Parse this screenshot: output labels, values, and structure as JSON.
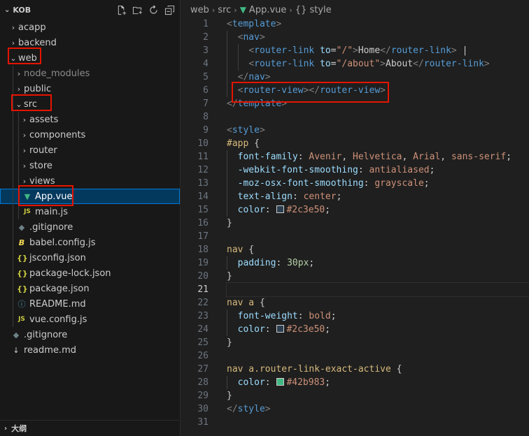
{
  "explorer": {
    "root": "KOB",
    "actions": [
      "new-file-icon",
      "new-folder-icon",
      "refresh-icon",
      "collapse-all-icon"
    ],
    "tree": [
      {
        "label": "acapp",
        "kind": "folder",
        "depth": 1,
        "expanded": false
      },
      {
        "label": "backend",
        "kind": "folder",
        "depth": 1,
        "expanded": false
      },
      {
        "label": "web",
        "kind": "folder",
        "depth": 1,
        "expanded": true
      },
      {
        "label": "node_modules",
        "kind": "folder",
        "depth": 2,
        "expanded": false,
        "dim": true
      },
      {
        "label": "public",
        "kind": "folder",
        "depth": 2,
        "expanded": false
      },
      {
        "label": "src",
        "kind": "folder",
        "depth": 2,
        "expanded": true
      },
      {
        "label": "assets",
        "kind": "folder",
        "depth": 3,
        "expanded": false
      },
      {
        "label": "components",
        "kind": "folder",
        "depth": 3,
        "expanded": false
      },
      {
        "label": "router",
        "kind": "folder",
        "depth": 3,
        "expanded": false
      },
      {
        "label": "store",
        "kind": "folder",
        "depth": 3,
        "expanded": false
      },
      {
        "label": "views",
        "kind": "folder",
        "depth": 3,
        "expanded": false
      },
      {
        "label": "App.vue",
        "kind": "vue",
        "depth": 3,
        "selected": true
      },
      {
        "label": "main.js",
        "kind": "js",
        "depth": 3
      },
      {
        "label": ".gitignore",
        "kind": "git",
        "depth": 2
      },
      {
        "label": "babel.config.js",
        "kind": "babel",
        "depth": 2
      },
      {
        "label": "jsconfig.json",
        "kind": "json",
        "depth": 2
      },
      {
        "label": "package-lock.json",
        "kind": "json",
        "depth": 2
      },
      {
        "label": "package.json",
        "kind": "json",
        "depth": 2
      },
      {
        "label": "README.md",
        "kind": "info",
        "depth": 2
      },
      {
        "label": "vue.config.js",
        "kind": "js",
        "depth": 2
      },
      {
        "label": ".gitignore",
        "kind": "git",
        "depth": 1
      },
      {
        "label": "readme.md",
        "kind": "md",
        "depth": 1
      }
    ],
    "outline_label": "大纲"
  },
  "breadcrumb": [
    "web",
    "src",
    "App.vue",
    "{} style"
  ],
  "editor": {
    "current_line": 21,
    "lines": [
      [
        [
          "tg",
          "<"
        ],
        [
          "tn",
          "template"
        ],
        [
          "tg",
          ">"
        ]
      ],
      [
        [
          "pl",
          "  "
        ],
        [
          "tg",
          "<"
        ],
        [
          "tn",
          "nav"
        ],
        [
          "tg",
          ">"
        ]
      ],
      [
        [
          "pl",
          "    "
        ],
        [
          "tg",
          "<"
        ],
        [
          "tn",
          "router-link"
        ],
        [
          "pl",
          " "
        ],
        [
          "an",
          "to"
        ],
        [
          "pl",
          "="
        ],
        [
          "av",
          "\"/\""
        ],
        [
          "tg",
          ">"
        ],
        [
          "pl",
          "Home"
        ],
        [
          "tg",
          "</"
        ],
        [
          "tn",
          "router-link"
        ],
        [
          "tg",
          ">"
        ],
        [
          "pl",
          " |"
        ]
      ],
      [
        [
          "pl",
          "    "
        ],
        [
          "tg",
          "<"
        ],
        [
          "tn",
          "router-link"
        ],
        [
          "pl",
          " "
        ],
        [
          "an",
          "to"
        ],
        [
          "pl",
          "="
        ],
        [
          "av",
          "\"/about\""
        ],
        [
          "tg",
          ">"
        ],
        [
          "pl",
          "About"
        ],
        [
          "tg",
          "</"
        ],
        [
          "tn",
          "router-link"
        ],
        [
          "tg",
          ">"
        ]
      ],
      [
        [
          "pl",
          "  "
        ],
        [
          "tg",
          "</"
        ],
        [
          "tn",
          "nav"
        ],
        [
          "tg",
          ">"
        ]
      ],
      [
        [
          "pl",
          "  "
        ],
        [
          "tg",
          "<"
        ],
        [
          "tn",
          "router-view"
        ],
        [
          "tg",
          "></"
        ],
        [
          "tn",
          "router-view"
        ],
        [
          "tg",
          ">"
        ]
      ],
      [
        [
          "tg",
          "</"
        ],
        [
          "tn",
          "template"
        ],
        [
          "tg",
          ">"
        ]
      ],
      [],
      [
        [
          "tg",
          "<"
        ],
        [
          "tn",
          "style"
        ],
        [
          "tg",
          ">"
        ]
      ],
      [
        [
          "sel",
          "#app"
        ],
        [
          "pl",
          " {"
        ]
      ],
      [
        [
          "pl",
          "  "
        ],
        [
          "prop",
          "font-family"
        ],
        [
          "pl",
          ": "
        ],
        [
          "val",
          "Avenir"
        ],
        [
          "pl",
          ", "
        ],
        [
          "val",
          "Helvetica"
        ],
        [
          "pl",
          ", "
        ],
        [
          "val",
          "Arial"
        ],
        [
          "pl",
          ", "
        ],
        [
          "val",
          "sans-serif"
        ],
        [
          "pl",
          ";"
        ]
      ],
      [
        [
          "pl",
          "  "
        ],
        [
          "prop",
          "-webkit-font-smoothing"
        ],
        [
          "pl",
          ": "
        ],
        [
          "val",
          "antialiased"
        ],
        [
          "pl",
          ";"
        ]
      ],
      [
        [
          "pl",
          "  "
        ],
        [
          "prop",
          "-moz-osx-font-smoothing"
        ],
        [
          "pl",
          ": "
        ],
        [
          "val",
          "grayscale"
        ],
        [
          "pl",
          ";"
        ]
      ],
      [
        [
          "pl",
          "  "
        ],
        [
          "prop",
          "text-align"
        ],
        [
          "pl",
          ": "
        ],
        [
          "val",
          "center"
        ],
        [
          "pl",
          ";"
        ]
      ],
      [
        [
          "pl",
          "  "
        ],
        [
          "prop",
          "color"
        ],
        [
          "pl",
          ": "
        ],
        [
          "swatch",
          "#2c3e50"
        ],
        [
          "val",
          "#2c3e50"
        ],
        [
          "pl",
          ";"
        ]
      ],
      [
        [
          "pl",
          "}"
        ]
      ],
      [],
      [
        [
          "sel",
          "nav"
        ],
        [
          "pl",
          " {"
        ]
      ],
      [
        [
          "pl",
          "  "
        ],
        [
          "prop",
          "padding"
        ],
        [
          "pl",
          ": "
        ],
        [
          "num",
          "30px"
        ],
        [
          "pl",
          ";"
        ]
      ],
      [
        [
          "pl",
          "}"
        ]
      ],
      [],
      [
        [
          "sel",
          "nav a"
        ],
        [
          "pl",
          " {"
        ]
      ],
      [
        [
          "pl",
          "  "
        ],
        [
          "prop",
          "font-weight"
        ],
        [
          "pl",
          ": "
        ],
        [
          "val",
          "bold"
        ],
        [
          "pl",
          ";"
        ]
      ],
      [
        [
          "pl",
          "  "
        ],
        [
          "prop",
          "color"
        ],
        [
          "pl",
          ": "
        ],
        [
          "swatch",
          "#2c3e50"
        ],
        [
          "val",
          "#2c3e50"
        ],
        [
          "pl",
          ";"
        ]
      ],
      [
        [
          "pl",
          "}"
        ]
      ],
      [],
      [
        [
          "sel",
          "nav a.router-link-exact-active"
        ],
        [
          "pl",
          " {"
        ]
      ],
      [
        [
          "pl",
          "  "
        ],
        [
          "prop",
          "color"
        ],
        [
          "pl",
          ": "
        ],
        [
          "swatch",
          "#42b983"
        ],
        [
          "val",
          "#42b983"
        ],
        [
          "pl",
          ";"
        ]
      ],
      [
        [
          "pl",
          "}"
        ]
      ],
      [
        [
          "tg",
          "</"
        ],
        [
          "tn",
          "style"
        ],
        [
          "tg",
          ">"
        ]
      ],
      []
    ]
  },
  "colors": {
    "vue": "#41b883",
    "js": "#cbcb41",
    "json": "#cbcb41",
    "info": "#519aba",
    "git": "#6d8086",
    "babel": "#f5da55",
    "highlight": "#e51400"
  }
}
